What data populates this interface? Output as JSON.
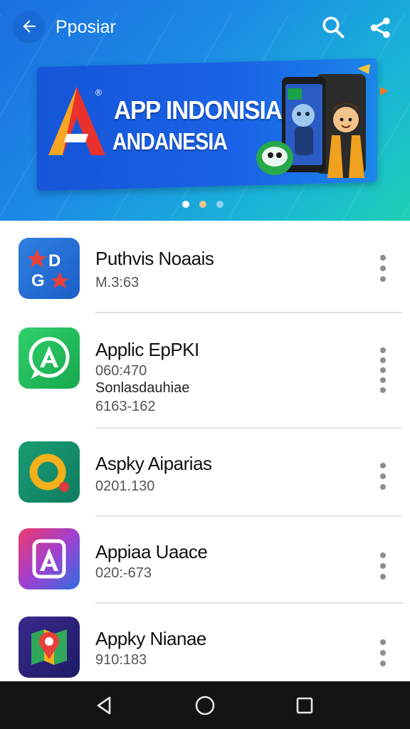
{
  "header": {
    "title": "Pposiar",
    "back_icon": "arrow-left-icon",
    "search_icon": "search-icon",
    "share_icon": "share-icon"
  },
  "banner": {
    "line1": "APP INDONISIA",
    "line2": "ANDANESIA",
    "logo_icon": "a-logo-icon",
    "registered_mark": "®",
    "slides": 3,
    "active_slide": 1
  },
  "apps": [
    {
      "name": "Puthvis Noaais",
      "lines": [
        "M.3:63"
      ],
      "icon": "dg-star-icon"
    },
    {
      "name": "Applic EpPKI",
      "lines": [
        "060:470",
        "Sonlasdauhiae",
        "6163-162"
      ],
      "icon": "green-a-chat-icon"
    },
    {
      "name": "Aspky Aiparias",
      "lines": [
        "0201.130"
      ],
      "icon": "yellow-ring-icon"
    },
    {
      "name": "Appiaa Uaace",
      "lines": [
        "020:-673"
      ],
      "icon": "gradient-a-icon"
    },
    {
      "name": "Appky Nianae",
      "lines": [
        "910:183"
      ],
      "icon": "map-pin-icon"
    }
  ],
  "navbar": {
    "back_icon": "nav-back-icon",
    "home_icon": "nav-home-icon",
    "recents_icon": "nav-recents-icon"
  },
  "colors": {
    "hero_start": "#1b6fe0",
    "hero_end": "#1fd0b5",
    "banner": "#1655d8",
    "navbar": "#141414"
  }
}
